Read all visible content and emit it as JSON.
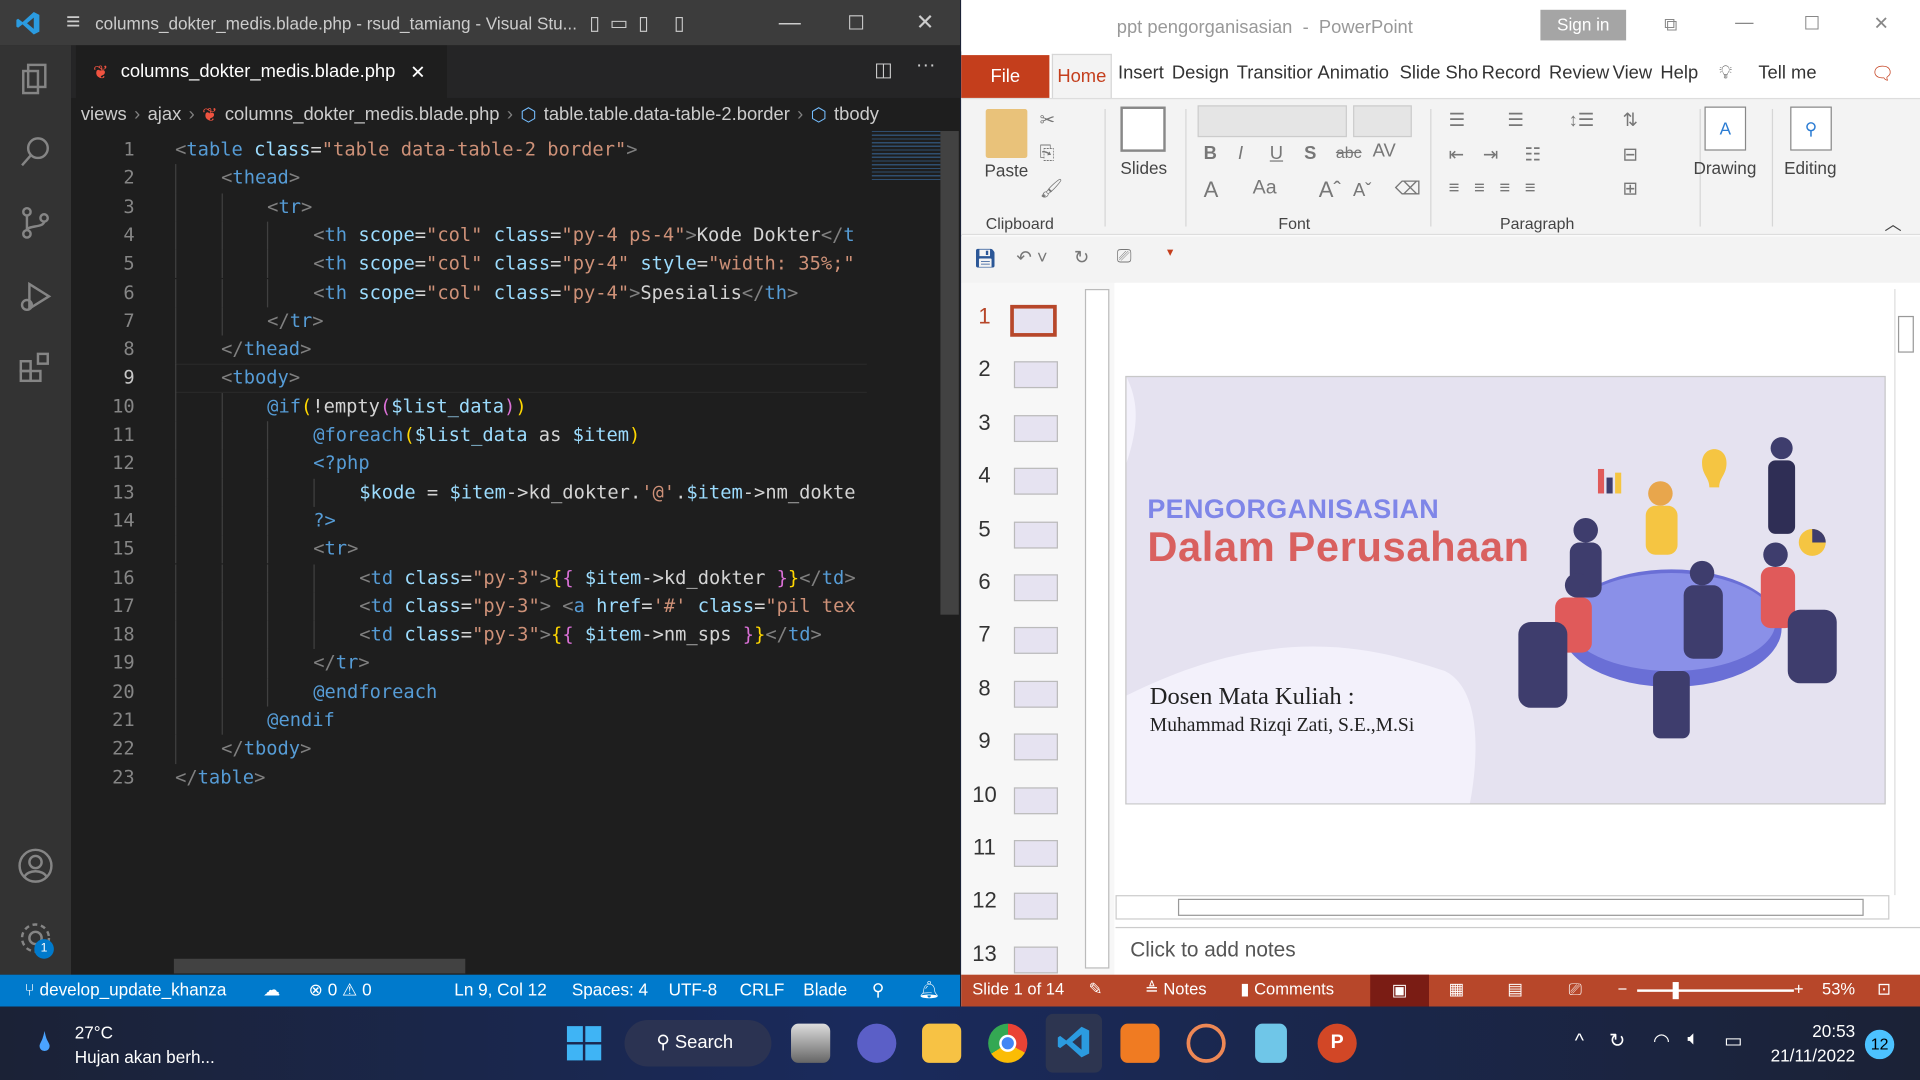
{
  "vscode": {
    "window_title": "columns_dokter_medis.blade.php - rsud_tamiang - Visual Stu...",
    "tab": {
      "label": "columns_dokter_medis.blade.php"
    },
    "breadcrumb": [
      "views",
      "ajax",
      "columns_dokter_medis.blade.php",
      "table.table.data-table-2.border",
      "tbody"
    ],
    "current_line": 9,
    "lines": [
      {
        "n": "1",
        "i": 0,
        "tk": [
          [
            "p",
            "<"
          ],
          [
            "t",
            "table"
          ],
          [
            "x",
            " "
          ],
          [
            "a",
            "class"
          ],
          [
            "x",
            "="
          ],
          [
            "s",
            "\"table data-table-2 border\""
          ],
          [
            "p",
            ">"
          ]
        ]
      },
      {
        "n": "2",
        "i": 1,
        "tk": [
          [
            "p",
            "<"
          ],
          [
            "t",
            "thead"
          ],
          [
            "p",
            ">"
          ]
        ]
      },
      {
        "n": "3",
        "i": 2,
        "tk": [
          [
            "p",
            "<"
          ],
          [
            "t",
            "tr"
          ],
          [
            "p",
            ">"
          ]
        ]
      },
      {
        "n": "4",
        "i": 3,
        "tk": [
          [
            "p",
            "<"
          ],
          [
            "t",
            "th"
          ],
          [
            "x",
            " "
          ],
          [
            "a",
            "scope"
          ],
          [
            "x",
            "="
          ],
          [
            "s",
            "\"col\""
          ],
          [
            "x",
            " "
          ],
          [
            "a",
            "class"
          ],
          [
            "x",
            "="
          ],
          [
            "s",
            "\"py-4 ps-4\""
          ],
          [
            "p",
            ">"
          ],
          [
            "x",
            "Kode Dokter"
          ],
          [
            "p",
            "</"
          ],
          [
            "t",
            "t"
          ]
        ]
      },
      {
        "n": "5",
        "i": 3,
        "tk": [
          [
            "p",
            "<"
          ],
          [
            "t",
            "th"
          ],
          [
            "x",
            " "
          ],
          [
            "a",
            "scope"
          ],
          [
            "x",
            "="
          ],
          [
            "s",
            "\"col\""
          ],
          [
            "x",
            " "
          ],
          [
            "a",
            "class"
          ],
          [
            "x",
            "="
          ],
          [
            "s",
            "\"py-4\""
          ],
          [
            "x",
            " "
          ],
          [
            "a",
            "style"
          ],
          [
            "x",
            "="
          ],
          [
            "s",
            "\"width: 35%;\""
          ]
        ]
      },
      {
        "n": "6",
        "i": 3,
        "tk": [
          [
            "p",
            "<"
          ],
          [
            "t",
            "th"
          ],
          [
            "x",
            " "
          ],
          [
            "a",
            "scope"
          ],
          [
            "x",
            "="
          ],
          [
            "s",
            "\"col\""
          ],
          [
            "x",
            " "
          ],
          [
            "a",
            "class"
          ],
          [
            "x",
            "="
          ],
          [
            "s",
            "\"py-4\""
          ],
          [
            "p",
            ">"
          ],
          [
            "x",
            "Spesialis"
          ],
          [
            "p",
            "</"
          ],
          [
            "t",
            "th"
          ],
          [
            "p",
            ">"
          ]
        ]
      },
      {
        "n": "7",
        "i": 2,
        "tk": [
          [
            "p",
            "</"
          ],
          [
            "t",
            "tr"
          ],
          [
            "p",
            ">"
          ]
        ]
      },
      {
        "n": "8",
        "i": 1,
        "tk": [
          [
            "p",
            "</"
          ],
          [
            "t",
            "thead"
          ],
          [
            "p",
            ">"
          ]
        ]
      },
      {
        "n": "9",
        "i": 1,
        "tk": [
          [
            "p",
            "<"
          ],
          [
            "t",
            "tbody"
          ],
          [
            "p",
            ">"
          ]
        ]
      },
      {
        "n": "10",
        "i": 2,
        "tk": [
          [
            "kw",
            "@if"
          ],
          [
            "y",
            "("
          ],
          [
            "x",
            "!empty"
          ],
          [
            "m",
            "("
          ],
          [
            "a",
            "$list_data"
          ],
          [
            "m",
            ")"
          ],
          [
            "y",
            ")"
          ]
        ]
      },
      {
        "n": "11",
        "i": 3,
        "tk": [
          [
            "kw",
            "@foreach"
          ],
          [
            "y",
            "("
          ],
          [
            "a",
            "$list_data"
          ],
          [
            "x",
            " as "
          ],
          [
            "a",
            "$item"
          ],
          [
            "y",
            ")"
          ]
        ]
      },
      {
        "n": "12",
        "i": 3,
        "tk": [
          [
            "t",
            "<?php"
          ]
        ]
      },
      {
        "n": "13",
        "i": 4,
        "tk": [
          [
            "a",
            "$kode"
          ],
          [
            "x",
            " = "
          ],
          [
            "a",
            "$item"
          ],
          [
            "x",
            "->kd_dokter."
          ],
          [
            "s",
            "'@'"
          ],
          [
            "x",
            "."
          ],
          [
            "a",
            "$item"
          ],
          [
            "x",
            "->nm_dokte"
          ]
        ]
      },
      {
        "n": "14",
        "i": 3,
        "tk": [
          [
            "t",
            "?>"
          ]
        ]
      },
      {
        "n": "15",
        "i": 3,
        "tk": [
          [
            "p",
            "<"
          ],
          [
            "t",
            "tr"
          ],
          [
            "p",
            ">"
          ]
        ]
      },
      {
        "n": "16",
        "i": 4,
        "tk": [
          [
            "p",
            "<"
          ],
          [
            "t",
            "td"
          ],
          [
            "x",
            " "
          ],
          [
            "a",
            "class"
          ],
          [
            "x",
            "="
          ],
          [
            "s",
            "\"py-3\""
          ],
          [
            "p",
            ">"
          ],
          [
            "y",
            "{"
          ],
          [
            "m",
            "{"
          ],
          [
            "x",
            " "
          ],
          [
            "a",
            "$item"
          ],
          [
            "x",
            "->kd_dokter "
          ],
          [
            "m",
            "}"
          ],
          [
            "y",
            "}"
          ],
          [
            "p",
            "</"
          ],
          [
            "t",
            "td"
          ],
          [
            "p",
            ">"
          ]
        ]
      },
      {
        "n": "17",
        "i": 4,
        "tk": [
          [
            "p",
            "<"
          ],
          [
            "t",
            "td"
          ],
          [
            "x",
            " "
          ],
          [
            "a",
            "class"
          ],
          [
            "x",
            "="
          ],
          [
            "s",
            "\"py-3\""
          ],
          [
            "p",
            "> <"
          ],
          [
            "t",
            "a"
          ],
          [
            "x",
            " "
          ],
          [
            "a",
            "href"
          ],
          [
            "x",
            "="
          ],
          [
            "s",
            "'#'"
          ],
          [
            "x",
            " "
          ],
          [
            "a",
            "class"
          ],
          [
            "x",
            "="
          ],
          [
            "s",
            "\"pil tex"
          ]
        ]
      },
      {
        "n": "18",
        "i": 4,
        "tk": [
          [
            "p",
            "<"
          ],
          [
            "t",
            "td"
          ],
          [
            "x",
            " "
          ],
          [
            "a",
            "class"
          ],
          [
            "x",
            "="
          ],
          [
            "s",
            "\"py-3\""
          ],
          [
            "p",
            ">"
          ],
          [
            "y",
            "{"
          ],
          [
            "m",
            "{"
          ],
          [
            "x",
            " "
          ],
          [
            "a",
            "$item"
          ],
          [
            "x",
            "->nm_sps "
          ],
          [
            "m",
            "}"
          ],
          [
            "y",
            "}"
          ],
          [
            "p",
            "</"
          ],
          [
            "t",
            "td"
          ],
          [
            "p",
            ">"
          ]
        ]
      },
      {
        "n": "19",
        "i": 3,
        "tk": [
          [
            "p",
            "</"
          ],
          [
            "t",
            "tr"
          ],
          [
            "p",
            ">"
          ]
        ]
      },
      {
        "n": "20",
        "i": 3,
        "tk": [
          [
            "kw",
            "@endforeach"
          ]
        ]
      },
      {
        "n": "21",
        "i": 2,
        "tk": [
          [
            "kw",
            "@endif"
          ]
        ]
      },
      {
        "n": "22",
        "i": 1,
        "tk": [
          [
            "p",
            "</"
          ],
          [
            "t",
            "tbody"
          ],
          [
            "p",
            ">"
          ]
        ]
      },
      {
        "n": "23",
        "i": 0,
        "tk": [
          [
            "p",
            "</"
          ],
          [
            "t",
            "table"
          ],
          [
            "p",
            ">"
          ]
        ]
      }
    ],
    "status": {
      "branch": "develop_update_khanza",
      "errors": "0",
      "warnings": "0",
      "position": "Ln 9, Col 12",
      "spaces": "Spaces: 4",
      "encoding": "UTF-8",
      "eol": "CRLF",
      "language": "Blade"
    },
    "settings_badge": "1"
  },
  "powerpoint": {
    "window_title": "ppt pengorganisasian  -  PowerPoint",
    "sign_in": "Sign in",
    "tabs": [
      "File",
      "Home",
      "Insert",
      "Design",
      "Transitior",
      "Animatio",
      "Slide Sho",
      "Record",
      "Review",
      "View",
      "Help"
    ],
    "active_tab": "Home",
    "tell_me": "Tell me",
    "ribbon": {
      "paste": "Paste",
      "slides": "Slides",
      "drawing": "Drawing",
      "editing": "Editing",
      "groups": [
        "Clipboard",
        "Font",
        "Paragraph"
      ]
    },
    "slide_numbers": [
      "1",
      "2",
      "3",
      "4",
      "5",
      "6",
      "7",
      "8",
      "9",
      "10",
      "11",
      "12",
      "13"
    ],
    "selected_slide": 1,
    "slide": {
      "heading": "PENGORGANISASIAN",
      "title": "Dalam Perusahaan",
      "lecturer_label": "Dosen Mata Kuliah :",
      "lecturer_name": "Muhammad Rizqi Zati, S.E.,M.Si"
    },
    "notes_placeholder": "Click to add notes",
    "status": {
      "slide": "Slide 1 of 14",
      "notes": "Notes",
      "comments": "Comments",
      "zoom": "53%"
    },
    "zoom_level": 53,
    "colors": {
      "accent": "#b7472a",
      "heading": "#7f86e8",
      "title": "#d9605f"
    }
  },
  "taskbar": {
    "weather_temp": "27°C",
    "weather_desc": "Hujan akan berh...",
    "search": "Search",
    "time": "20:53",
    "date": "21/11/2022",
    "notification_count": "12",
    "apps": [
      "start",
      "search",
      "task-view",
      "teams",
      "file-explorer",
      "chrome",
      "vscode",
      "xampp",
      "app",
      "notepad",
      "powerpoint"
    ]
  }
}
